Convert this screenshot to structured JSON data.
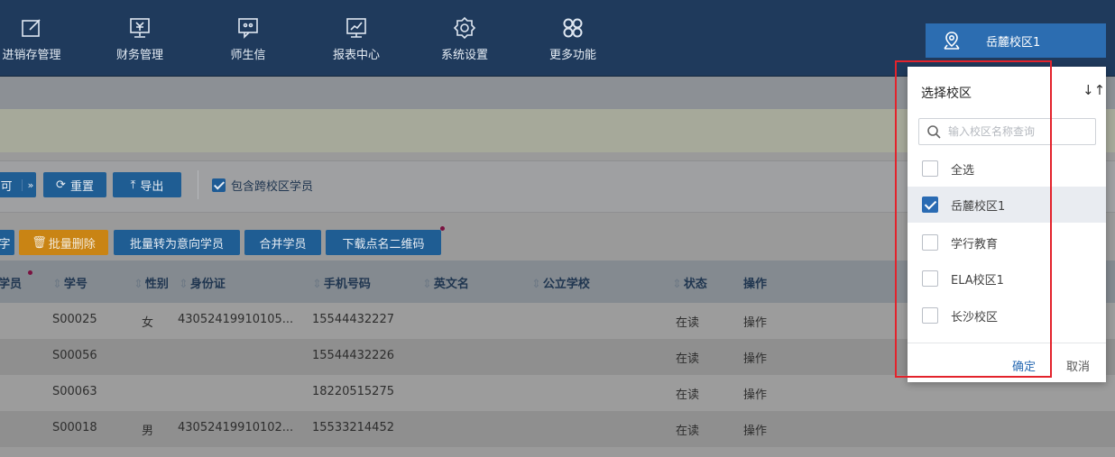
{
  "nav": {
    "items": [
      {
        "label": "进销存管理",
        "icon": "edit-icon"
      },
      {
        "label": "财务管理",
        "icon": "finance-monitor-icon"
      },
      {
        "label": "师生信",
        "icon": "message-icon"
      },
      {
        "label": "报表中心",
        "icon": "report-chart-icon"
      },
      {
        "label": "系统设置",
        "icon": "gear-icon"
      },
      {
        "label": "更多功能",
        "icon": "grid-more-icon"
      }
    ],
    "campus_button": "岳麓校区1"
  },
  "toolbar": {
    "partial_button": "可",
    "reset": "重置",
    "export": "导出",
    "include_cross_campus": "包含跨校区学员",
    "include_cross_campus_checked": true
  },
  "actions": {
    "partial": "字",
    "batch_delete": "批量删除",
    "batch_to_intent": "批量转为意向学员",
    "merge": "合并学员",
    "download_qr": "下载点名二维码"
  },
  "table": {
    "headers": {
      "first": "学员",
      "student_no": "学号",
      "gender": "性别",
      "id_card": "身份证",
      "phone": "手机号码",
      "english_name": "英文名",
      "public_school": "公立学校",
      "status": "状态",
      "operation": "操作"
    },
    "rows": [
      {
        "student_no": "S00025",
        "gender": "女",
        "id_card": "43052419910105...",
        "phone": "15544432227",
        "status": "在读",
        "op": "操作"
      },
      {
        "student_no": "S00056",
        "gender": "",
        "id_card": "",
        "phone": "15544432226",
        "status": "在读",
        "op": "操作"
      },
      {
        "student_no": "S00063",
        "gender": "",
        "id_card": "",
        "phone": "18220515275",
        "status": "在读",
        "op": "操作"
      },
      {
        "student_no": "S00018",
        "gender": "男",
        "id_card": "43052419910102...",
        "phone": "15533214452",
        "status": "在读",
        "op": "操作"
      }
    ]
  },
  "dropdown": {
    "title": "选择校区",
    "sort_icon": "↓↑",
    "search_placeholder": "输入校区名称查询",
    "options": [
      {
        "label": "全选",
        "checked": false
      },
      {
        "label": "岳麓校区1",
        "checked": true
      },
      {
        "label": "学行教育",
        "checked": false
      },
      {
        "label": "ELA校区1",
        "checked": false
      },
      {
        "label": "长沙校区",
        "checked": false
      }
    ],
    "confirm": "确定",
    "cancel": "取消"
  },
  "colors": {
    "nav_bg": "#1f3a5c",
    "accent": "#2c6db1",
    "highlight_border": "#e3232c",
    "orange": "#c98414"
  }
}
